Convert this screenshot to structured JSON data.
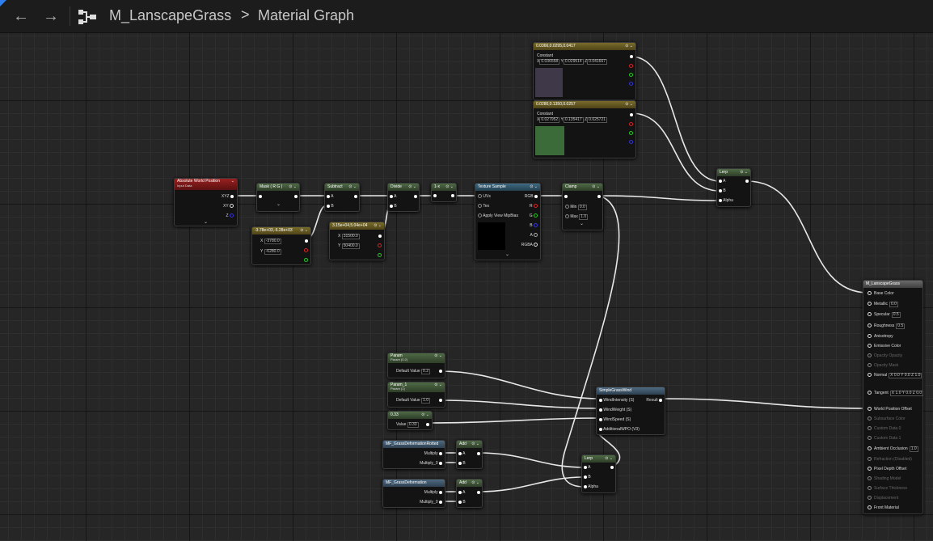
{
  "breadcrumb": {
    "asset": "M_LanscapeGrass",
    "separator": ">",
    "page": "Material Graph"
  },
  "nav": {
    "back": "←",
    "forward": "→"
  },
  "nodes": {
    "colA": {
      "title": "0.0366,0.0295,0.0417",
      "label": "Constant",
      "x_label": "X",
      "x": "0.036558",
      "y_label": "Y",
      "y": "0.029514",
      "z_label": "Z",
      "z": "0.041667",
      "swatch": "#3f3848"
    },
    "colB": {
      "title": "0.0280,0.1350,0.0257",
      "label": "Constant",
      "x_label": "X",
      "x": "0.027952",
      "y_label": "Y",
      "y": "0.135417",
      "z_label": "Z",
      "z": "0.025721",
      "swatch": "#3a6b38"
    },
    "absWorld": {
      "title": "Absolute World Position",
      "subtitle": "Input Data",
      "p1": "XYZ",
      "p2": "XY",
      "p3": "Z"
    },
    "mask": {
      "title": "Mask ( R G )"
    },
    "subtract": {
      "title": "Subtract",
      "a": "A",
      "b": "B"
    },
    "const2a": {
      "title": "-3.78e+03,-6.28e+03",
      "x_label": "X",
      "x": "-3780.0",
      "y_label": "Y",
      "y": "-6280.0"
    },
    "const2b": {
      "title": "3.15e+04,5.04e+04",
      "x_label": "X",
      "x": "31500.0",
      "y_label": "Y",
      "y": "50400.0"
    },
    "divide": {
      "title": "Divide",
      "a": "A",
      "b": "B"
    },
    "oneMinus": {
      "title": "1-x"
    },
    "tex": {
      "title": "Texture Sample",
      "uvs": "UVs",
      "tex": "Tex",
      "mip": "Apply View MipBias",
      "rgb": "RGB",
      "r": "R",
      "g": "G",
      "b": "B",
      "a": "A",
      "rgba": "RGBA"
    },
    "clamp": {
      "title": "Clamp",
      "min_label": "Min",
      "min": "0.0",
      "max_label": "Max",
      "max": "1.0"
    },
    "lerp1": {
      "title": "Lerp",
      "a": "A",
      "b": "B",
      "alpha": "Alpha"
    },
    "param": {
      "title": "Param",
      "subtitle": "Param (0.2)",
      "label": "Default Value",
      "value": "0.2"
    },
    "param1": {
      "title": "Param_1",
      "subtitle": "Param (1)",
      "label": "Default Value",
      "value": "1.0"
    },
    "constS": {
      "title": "0.33",
      "label": "Value",
      "value": "0.33"
    },
    "wind": {
      "title": "SimpleGrassWind",
      "in1": "WindIntensity (S)",
      "in2": "WindWeight (S)",
      "in3": "WindSpeed (S)",
      "in4": "AdditionalWPO (V3)",
      "out": "Result"
    },
    "mfRot": {
      "title": "MF_GrassDeformationRotted",
      "o1": "Multiply",
      "o2": "Multiply_0"
    },
    "mfDef": {
      "title": "MF_GrassDeformation",
      "o1": "Multiply",
      "o2": "Multiply_0"
    },
    "add1": {
      "title": "Add",
      "a": "A",
      "b": "B"
    },
    "add2": {
      "title": "Add",
      "a": "A",
      "b": "B"
    },
    "lerp2": {
      "title": "Lerp",
      "a": "A",
      "b": "B",
      "alpha": "Alpha"
    },
    "result": {
      "title": "M_LanscapeGrass",
      "pins": [
        {
          "label": "Base Color",
          "active": true,
          "value": ""
        },
        {
          "label": "Metallic",
          "active": true,
          "value": "0.0"
        },
        {
          "label": "Specular",
          "active": true,
          "value": "0.5"
        },
        {
          "label": "Roughness",
          "active": true,
          "value": "0.5"
        },
        {
          "label": "Anisotropy",
          "active": true,
          "value": ""
        },
        {
          "label": "Emissive Color",
          "active": true,
          "value": ""
        },
        {
          "label": "Opacity Opacity",
          "active": false,
          "value": ""
        },
        {
          "label": "Opacity Mask",
          "active": false,
          "value": ""
        },
        {
          "label": "Normal",
          "active": true,
          "value": "X 0.0 Y 0.0 Z 1.0"
        },
        {
          "label": "Tangent",
          "active": true,
          "value": "X 1.0 Y 0.0 Z 0.0"
        },
        {
          "label": "World Position Offset",
          "active": true,
          "value": ""
        },
        {
          "label": "Subsurface Color",
          "active": false,
          "value": ""
        },
        {
          "label": "Custom Data 0",
          "active": false,
          "value": ""
        },
        {
          "label": "Custom Data 1",
          "active": false,
          "value": ""
        },
        {
          "label": "Ambient Occlusion",
          "active": true,
          "value": "1.0"
        },
        {
          "label": "Refraction (Disabled)",
          "active": false,
          "value": ""
        },
        {
          "label": "Pixel Depth Offset",
          "active": true,
          "value": ""
        },
        {
          "label": "Shading Model",
          "active": false,
          "value": ""
        },
        {
          "label": "Surface Thickness",
          "active": false,
          "value": ""
        },
        {
          "label": "Displacement",
          "active": false,
          "value": ""
        },
        {
          "label": "Front Material",
          "active": true,
          "value": ""
        }
      ]
    }
  }
}
